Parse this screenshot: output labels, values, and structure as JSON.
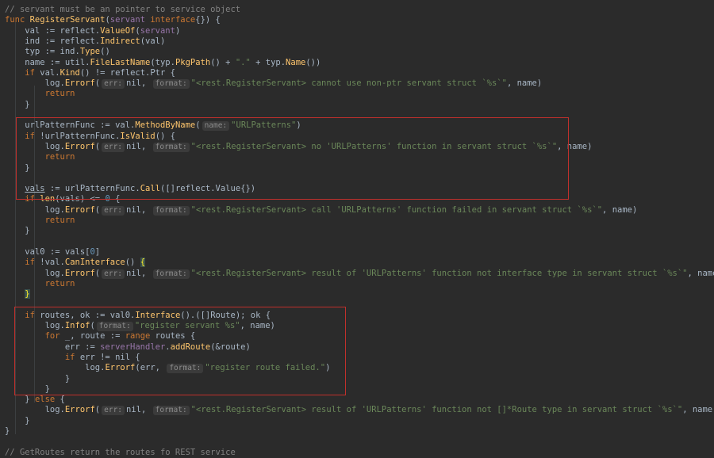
{
  "editor": {
    "lines": [
      [
        {
          "t": "// servant must be an pointer to service object",
          "c": "cm"
        }
      ],
      [
        {
          "t": "func ",
          "c": "kw"
        },
        {
          "t": "RegisterServant",
          "c": "fn"
        },
        {
          "t": "(",
          "c": "pu"
        },
        {
          "t": "servant ",
          "c": "par"
        },
        {
          "t": "interface",
          "c": "kw"
        },
        {
          "t": "{}) {",
          "c": "pu"
        }
      ],
      [
        {
          "t": "    val := reflect.",
          "c": "pu"
        },
        {
          "t": "ValueOf",
          "c": "fn"
        },
        {
          "t": "(",
          "c": "pu"
        },
        {
          "t": "servant",
          "c": "par"
        },
        {
          "t": ")",
          "c": "pu"
        }
      ],
      [
        {
          "t": "    ind := reflect.",
          "c": "pu"
        },
        {
          "t": "Indirect",
          "c": "fn"
        },
        {
          "t": "(val)",
          "c": "pu"
        }
      ],
      [
        {
          "t": "    typ := ind.",
          "c": "pu"
        },
        {
          "t": "Type",
          "c": "fn"
        },
        {
          "t": "()",
          "c": "pu"
        }
      ],
      [
        {
          "t": "    name := util.",
          "c": "pu"
        },
        {
          "t": "FileLastName",
          "c": "fn"
        },
        {
          "t": "(typ.",
          "c": "pu"
        },
        {
          "t": "PkgPath",
          "c": "fn"
        },
        {
          "t": "() + ",
          "c": "pu"
        },
        {
          "t": "\".\"",
          "c": "str"
        },
        {
          "t": " + typ.",
          "c": "pu"
        },
        {
          "t": "Name",
          "c": "fn"
        },
        {
          "t": "())",
          "c": "pu"
        }
      ],
      [
        {
          "t": "    ",
          "c": "pu"
        },
        {
          "t": "if ",
          "c": "kw"
        },
        {
          "t": "val.",
          "c": "pu"
        },
        {
          "t": "Kind",
          "c": "fn"
        },
        {
          "t": "() != reflect.Ptr {",
          "c": "pu"
        }
      ],
      [
        {
          "t": "        log.",
          "c": "pu"
        },
        {
          "t": "Errorf",
          "c": "fn"
        },
        {
          "t": "(",
          "c": "pu"
        },
        {
          "t": "err:",
          "c": "hint"
        },
        {
          "t": "nil, ",
          "c": "pu"
        },
        {
          "t": "format:",
          "c": "hint"
        },
        {
          "t": "\"<rest.RegisterServant> cannot use non-ptr servant struct `%s`\"",
          "c": "str"
        },
        {
          "t": ", name)",
          "c": "pu"
        }
      ],
      [
        {
          "t": "        ",
          "c": "pu"
        },
        {
          "t": "return",
          "c": "kw"
        }
      ],
      [
        {
          "t": "    }",
          "c": "pu"
        }
      ],
      [
        {
          "t": "",
          "c": "pu"
        }
      ],
      [
        {
          "t": "    urlPatternFunc := val.",
          "c": "pu"
        },
        {
          "t": "MethodByName",
          "c": "fn"
        },
        {
          "t": "(",
          "c": "pu"
        },
        {
          "t": "name:",
          "c": "hint"
        },
        {
          "t": "\"URLPatterns\"",
          "c": "str"
        },
        {
          "t": ")",
          "c": "pu"
        }
      ],
      [
        {
          "t": "    ",
          "c": "pu"
        },
        {
          "t": "if ",
          "c": "kw"
        },
        {
          "t": "!urlPatternFunc.",
          "c": "pu"
        },
        {
          "t": "IsValid",
          "c": "fn"
        },
        {
          "t": "() {",
          "c": "pu"
        }
      ],
      [
        {
          "t": "        log.",
          "c": "pu"
        },
        {
          "t": "Errorf",
          "c": "fn"
        },
        {
          "t": "(",
          "c": "pu"
        },
        {
          "t": "err:",
          "c": "hint"
        },
        {
          "t": "nil, ",
          "c": "pu"
        },
        {
          "t": "format:",
          "c": "hint"
        },
        {
          "t": "\"<rest.RegisterServant> no 'URLPatterns' function in servant struct `%s`\"",
          "c": "str"
        },
        {
          "t": ", name)",
          "c": "pu"
        }
      ],
      [
        {
          "t": "        ",
          "c": "pu"
        },
        {
          "t": "return",
          "c": "kw"
        }
      ],
      [
        {
          "t": "    }",
          "c": "pu"
        }
      ],
      [
        {
          "t": "",
          "c": "pu"
        }
      ],
      [
        {
          "t": "    ",
          "c": "pu"
        },
        {
          "t": "vals",
          "c": "ul"
        },
        {
          "t": " := urlPatternFunc.",
          "c": "pu"
        },
        {
          "t": "Call",
          "c": "fn"
        },
        {
          "t": "([]reflect.Value{})",
          "c": "pu"
        }
      ],
      [
        {
          "t": "    ",
          "c": "pu"
        },
        {
          "t": "if ",
          "c": "kw"
        },
        {
          "t": "len",
          "c": "fn"
        },
        {
          "t": "(vals) <= ",
          "c": "pu"
        },
        {
          "t": "0",
          "c": "num"
        },
        {
          "t": " {",
          "c": "pu"
        }
      ],
      [
        {
          "t": "        log.",
          "c": "pu"
        },
        {
          "t": "Errorf",
          "c": "fn"
        },
        {
          "t": "(",
          "c": "pu"
        },
        {
          "t": "err:",
          "c": "hint"
        },
        {
          "t": "nil, ",
          "c": "pu"
        },
        {
          "t": "format:",
          "c": "hint"
        },
        {
          "t": "\"<rest.RegisterServant> call 'URLPatterns' function failed in servant struct `%s`\"",
          "c": "str"
        },
        {
          "t": ", name)",
          "c": "pu"
        }
      ],
      [
        {
          "t": "        ",
          "c": "pu"
        },
        {
          "t": "return",
          "c": "kw"
        }
      ],
      [
        {
          "t": "    }",
          "c": "pu"
        }
      ],
      [
        {
          "t": "",
          "c": "pu"
        }
      ],
      [
        {
          "t": "    val0 := vals[",
          "c": "pu"
        },
        {
          "t": "0",
          "c": "num"
        },
        {
          "t": "]",
          "c": "pu"
        }
      ],
      [
        {
          "t": "    ",
          "c": "pu"
        },
        {
          "t": "if ",
          "c": "kw"
        },
        {
          "t": "!val.",
          "c": "pu"
        },
        {
          "t": "CanInterface",
          "c": "fn"
        },
        {
          "t": "() ",
          "c": "pu"
        },
        {
          "t": "{",
          "c": "brace-hl"
        }
      ],
      [
        {
          "t": "        log.",
          "c": "pu"
        },
        {
          "t": "Errorf",
          "c": "fn"
        },
        {
          "t": "(",
          "c": "pu"
        },
        {
          "t": "err:",
          "c": "hint"
        },
        {
          "t": "nil, ",
          "c": "pu"
        },
        {
          "t": "format:",
          "c": "hint"
        },
        {
          "t": "\"<rest.RegisterServant> result of 'URLPatterns' function not interface type in servant struct `%s`\"",
          "c": "str"
        },
        {
          "t": ", name)",
          "c": "pu"
        }
      ],
      [
        {
          "t": "        ",
          "c": "pu"
        },
        {
          "t": "return",
          "c": "kw"
        }
      ],
      [
        {
          "t": "    ",
          "c": "pu"
        },
        {
          "t": "}",
          "c": "brace-hl"
        }
      ],
      [
        {
          "t": "",
          "c": "pu"
        }
      ],
      [
        {
          "t": "    ",
          "c": "pu"
        },
        {
          "t": "if ",
          "c": "kw"
        },
        {
          "t": "routes, ok := val0.",
          "c": "pu"
        },
        {
          "t": "Interface",
          "c": "fn"
        },
        {
          "t": "().([]Route); ok {",
          "c": "pu"
        }
      ],
      [
        {
          "t": "        log.",
          "c": "pu"
        },
        {
          "t": "Infof",
          "c": "fn"
        },
        {
          "t": "(",
          "c": "pu"
        },
        {
          "t": "format:",
          "c": "hint"
        },
        {
          "t": "\"register servant %s\"",
          "c": "str"
        },
        {
          "t": ", name)",
          "c": "pu"
        }
      ],
      [
        {
          "t": "        ",
          "c": "pu"
        },
        {
          "t": "for ",
          "c": "kw"
        },
        {
          "t": "_, route := ",
          "c": "pu"
        },
        {
          "t": "range ",
          "c": "kw"
        },
        {
          "t": "routes {",
          "c": "pu"
        }
      ],
      [
        {
          "t": "            err := ",
          "c": "pu"
        },
        {
          "t": "serverHandler",
          "c": "par"
        },
        {
          "t": ".",
          "c": "pu"
        },
        {
          "t": "addRoute",
          "c": "fn"
        },
        {
          "t": "(&route)",
          "c": "pu"
        }
      ],
      [
        {
          "t": "            ",
          "c": "pu"
        },
        {
          "t": "if ",
          "c": "kw"
        },
        {
          "t": "err != nil {",
          "c": "pu"
        }
      ],
      [
        {
          "t": "                log.",
          "c": "pu"
        },
        {
          "t": "Errorf",
          "c": "fn"
        },
        {
          "t": "(err, ",
          "c": "pu"
        },
        {
          "t": "format:",
          "c": "hint"
        },
        {
          "t": "\"register route failed.\"",
          "c": "str"
        },
        {
          "t": ")",
          "c": "pu"
        }
      ],
      [
        {
          "t": "            }",
          "c": "pu"
        }
      ],
      [
        {
          "t": "        }",
          "c": "pu"
        }
      ],
      [
        {
          "t": "    } ",
          "c": "pu"
        },
        {
          "t": "else ",
          "c": "kw"
        },
        {
          "t": "{",
          "c": "pu"
        }
      ],
      [
        {
          "t": "        log.",
          "c": "pu"
        },
        {
          "t": "Errorf",
          "c": "fn"
        },
        {
          "t": "(",
          "c": "pu"
        },
        {
          "t": "err:",
          "c": "hint"
        },
        {
          "t": "nil, ",
          "c": "pu"
        },
        {
          "t": "format:",
          "c": "hint"
        },
        {
          "t": "\"<rest.RegisterServant> result of 'URLPatterns' function not []*Route type in servant struct `%s`\"",
          "c": "str"
        },
        {
          "t": ", name)",
          "c": "pu"
        }
      ],
      [
        {
          "t": "    }",
          "c": "pu"
        }
      ],
      [
        {
          "t": "}",
          "c": "pu"
        }
      ],
      [
        {
          "t": "",
          "c": "pu"
        }
      ],
      [
        {
          "t": "// GetRoutes return the routes fo REST service",
          "c": "cm"
        }
      ]
    ]
  },
  "colors": {
    "background": "#2b2b2b",
    "keyword": "#cc7832",
    "function": "#ffc66d",
    "string": "#6a8759",
    "comment": "#808080",
    "highlight_box": "#c0302c"
  }
}
